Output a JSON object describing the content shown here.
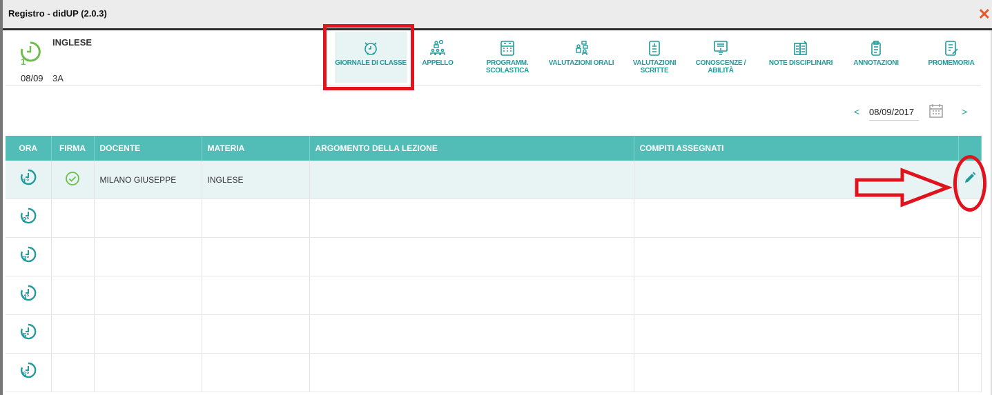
{
  "window": {
    "title": "Registro - didUP (2.0.3)",
    "close_label": "✕"
  },
  "info": {
    "hour": "1°",
    "date": "08/09",
    "subject": "INGLESE",
    "class": "3A"
  },
  "toolbar": [
    {
      "label": "GIORNALE DI CLASSE",
      "icon": "alarm-clock-icon"
    },
    {
      "label": "APPELLO",
      "icon": "roll-call-icon"
    },
    {
      "label": "PROGRAMM.\nSCOLASTICA",
      "icon": "calendar-program-icon"
    },
    {
      "label": "VALUTAZIONI ORALI",
      "icon": "oral-evaluation-icon"
    },
    {
      "label": "VALUTAZIONI\nSCRITTE",
      "icon": "written-evaluation-icon"
    },
    {
      "label": "CONOSCENZE /\nABILITÀ",
      "icon": "knowledge-skills-icon"
    },
    {
      "label": "NOTE DISCIPLINARI",
      "icon": "disciplinary-notes-icon"
    },
    {
      "label": "ANNOTAZIONI",
      "icon": "annotations-icon"
    },
    {
      "label": "PROMEMORIA",
      "icon": "reminder-icon"
    }
  ],
  "datebar": {
    "prev": "<",
    "date": "08/09/2017",
    "next": ">"
  },
  "table": {
    "headers": [
      "ORA",
      "FIRMA",
      "DOCENTE",
      "MATERIA",
      "ARGOMENTO DELLA LEZIONE",
      "COMPITI ASSEGNATI",
      ""
    ],
    "rows": [
      {
        "hour": "1°",
        "docente": "MILANO GIUSEPPE",
        "materia": "INGLESE",
        "argomento": "",
        "compiti": ""
      },
      {
        "hour": "2°",
        "docente": "",
        "materia": "",
        "argomento": "",
        "compiti": ""
      },
      {
        "hour": "3°",
        "docente": "",
        "materia": "",
        "argomento": "",
        "compiti": ""
      },
      {
        "hour": "4°",
        "docente": "",
        "materia": "",
        "argomento": "",
        "compiti": ""
      },
      {
        "hour": "5°",
        "docente": "",
        "materia": "",
        "argomento": "",
        "compiti": ""
      },
      {
        "hour": "6°",
        "docente": "",
        "materia": "",
        "argomento": "",
        "compiti": ""
      }
    ]
  },
  "colors": {
    "accent": "#52bdb6",
    "icon": "#1f9b9b",
    "clock": "#6cbf4b",
    "annotation": "#e0141e"
  }
}
